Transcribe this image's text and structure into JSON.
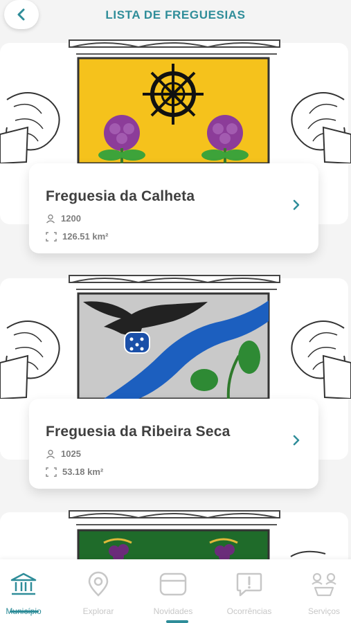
{
  "header": {
    "title": "LISTA DE FREGUESIAS"
  },
  "parishes": [
    {
      "name": "Freguesia da Calheta",
      "population": "1200",
      "area": "126.51 km²"
    },
    {
      "name": "Freguesia da Ribeira Seca",
      "population": "1025",
      "area": "53.18 km²"
    }
  ],
  "nav": {
    "items": [
      {
        "label": "Município",
        "icon": "bank-icon",
        "active": true
      },
      {
        "label": "Explorar",
        "icon": "location-pin-icon",
        "active": false
      },
      {
        "label": "Novidades",
        "icon": "news-card-icon",
        "active": false
      },
      {
        "label": "Ocorrências",
        "icon": "alert-bubble-icon",
        "active": false
      },
      {
        "label": "Serviços",
        "icon": "services-icon",
        "active": false
      }
    ]
  },
  "colors": {
    "accent": "#2f8d99",
    "text": "#3f3f3f",
    "muted": "#7d7d7d",
    "inactive": "#c7c7c7"
  }
}
